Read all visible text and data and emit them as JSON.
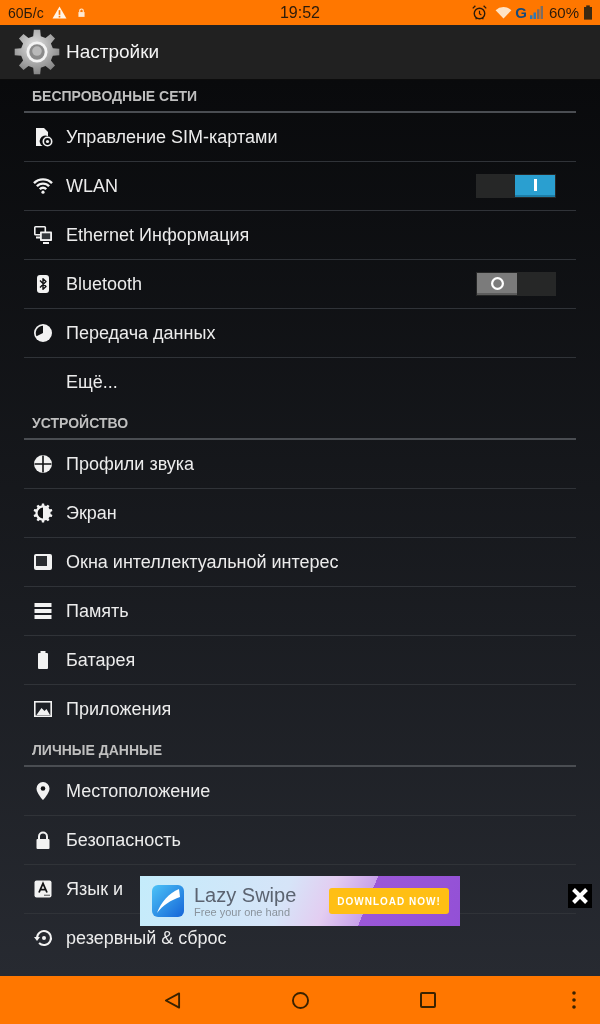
{
  "status_bar": {
    "data_speed": "60Б/с",
    "time": "19:52",
    "network_type": "G",
    "battery": "60%"
  },
  "action_bar": {
    "title": "Настройки"
  },
  "sections": [
    {
      "title": "БЕСПРОВОДНЫЕ СЕТИ",
      "items": [
        {
          "kind": "link",
          "label": "Управление SIM-картами"
        },
        {
          "kind": "switch",
          "label": "WLAN",
          "on": true
        },
        {
          "kind": "link",
          "label": "Ethernet Информация"
        },
        {
          "kind": "switch",
          "label": "Bluetooth",
          "on": false
        },
        {
          "kind": "link",
          "label": "Передача данных"
        },
        {
          "kind": "link",
          "label": "Ещё..."
        }
      ]
    },
    {
      "title": "УСТРОЙСТВО",
      "items": [
        {
          "kind": "link",
          "label": "Профили звука"
        },
        {
          "kind": "link",
          "label": "Экран"
        },
        {
          "kind": "link",
          "label": "Окна интеллектуальной интерес"
        },
        {
          "kind": "link",
          "label": "Память"
        },
        {
          "kind": "link",
          "label": "Батарея"
        },
        {
          "kind": "link",
          "label": "Приложения"
        }
      ]
    },
    {
      "title": "ЛИЧНЫЕ ДАННЫЕ",
      "items": [
        {
          "kind": "link",
          "label": "Местоположение"
        },
        {
          "kind": "link",
          "label": "Безопасность"
        },
        {
          "kind": "link",
          "label": "Язык и"
        },
        {
          "kind": "link",
          "label": "резервный & сброс"
        }
      ]
    }
  ],
  "ad": {
    "title": "Lazy Swipe",
    "tagline": "Free your one hand",
    "button": "DOWNLOAD NOW!"
  }
}
